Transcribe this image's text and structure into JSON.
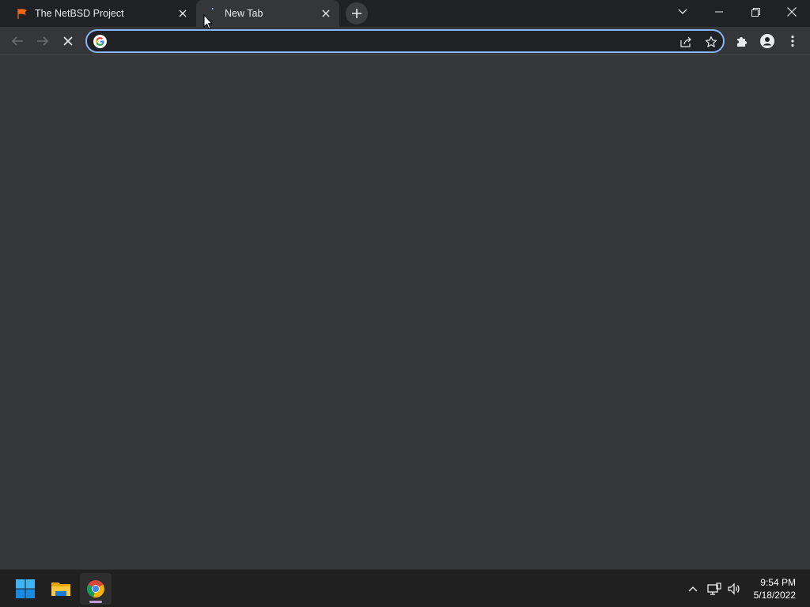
{
  "tabs": [
    {
      "title": "The NetBSD Project",
      "active": false,
      "favicon": "netbsd-flag-icon"
    },
    {
      "title": "New Tab",
      "active": true,
      "favicon": "loading-spinner-icon"
    }
  ],
  "omnibox": {
    "value": "",
    "placeholder": ""
  },
  "colors": {
    "accent": "#8ab4f8",
    "background": "#35363a",
    "tabstrip": "#202124"
  },
  "clock": {
    "time": "9:54 PM",
    "date": "5/18/2022"
  }
}
